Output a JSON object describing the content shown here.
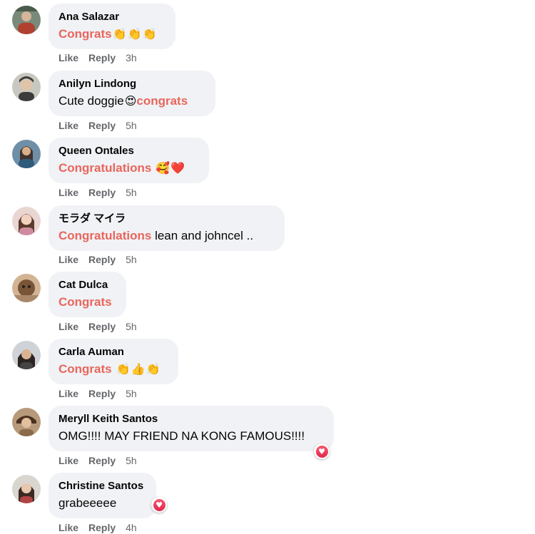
{
  "comments": [
    {
      "author": "Ana Salazar",
      "segments": [
        {
          "text": "Congrats",
          "hl": true
        }
      ],
      "emojis": [
        "👏",
        "👏",
        "👏"
      ],
      "time": "3h",
      "reaction": null
    },
    {
      "author": "Anilyn Lindong",
      "segments": [
        {
          "text": "Cute doggie",
          "hl": false
        }
      ],
      "emojis": [
        "😍"
      ],
      "tail": {
        "text": "congrats",
        "hl": true
      },
      "time": "5h",
      "reaction": null
    },
    {
      "author": "Queen Ontales",
      "segments": [
        {
          "text": "Congratulations",
          "hl": true
        }
      ],
      "emojis": [
        "🥰",
        "❤️"
      ],
      "time": "5h",
      "reaction": null
    },
    {
      "author": "モラダ マイラ",
      "segments": [
        {
          "text": "Congratulations",
          "hl": true
        },
        {
          "text": " lean and johncel ..",
          "hl": false
        }
      ],
      "emojis": [],
      "time": "5h",
      "reaction": null
    },
    {
      "author": "Cat Dulca",
      "segments": [
        {
          "text": "Congrats",
          "hl": true
        }
      ],
      "emojis": [],
      "time": "5h",
      "reaction": null
    },
    {
      "author": "Carla Auman",
      "segments": [
        {
          "text": "Congrats",
          "hl": true
        }
      ],
      "emojis": [
        "👏",
        "👍",
        "👏"
      ],
      "time": "5h",
      "reaction": null
    },
    {
      "author": "Meryll Keith Santos",
      "segments": [
        {
          "text": "OMG!!!! MAY FRIEND NA KONG FAMOUS!!!!",
          "hl": false
        }
      ],
      "emojis": [],
      "time": "5h",
      "reaction": "love"
    },
    {
      "author": "Christine Santos",
      "segments": [
        {
          "text": "grabeeeee",
          "hl": false
        }
      ],
      "emojis": [],
      "time": "4h",
      "reaction": "love"
    }
  ],
  "actions": {
    "like": "Like",
    "reply": "Reply"
  },
  "colors": {
    "highlight": "#e9655c",
    "bubble": "#f0f2f5",
    "meta": "#65676b",
    "love": "#e2264d"
  },
  "icons": {
    "love": "heart-icon"
  }
}
